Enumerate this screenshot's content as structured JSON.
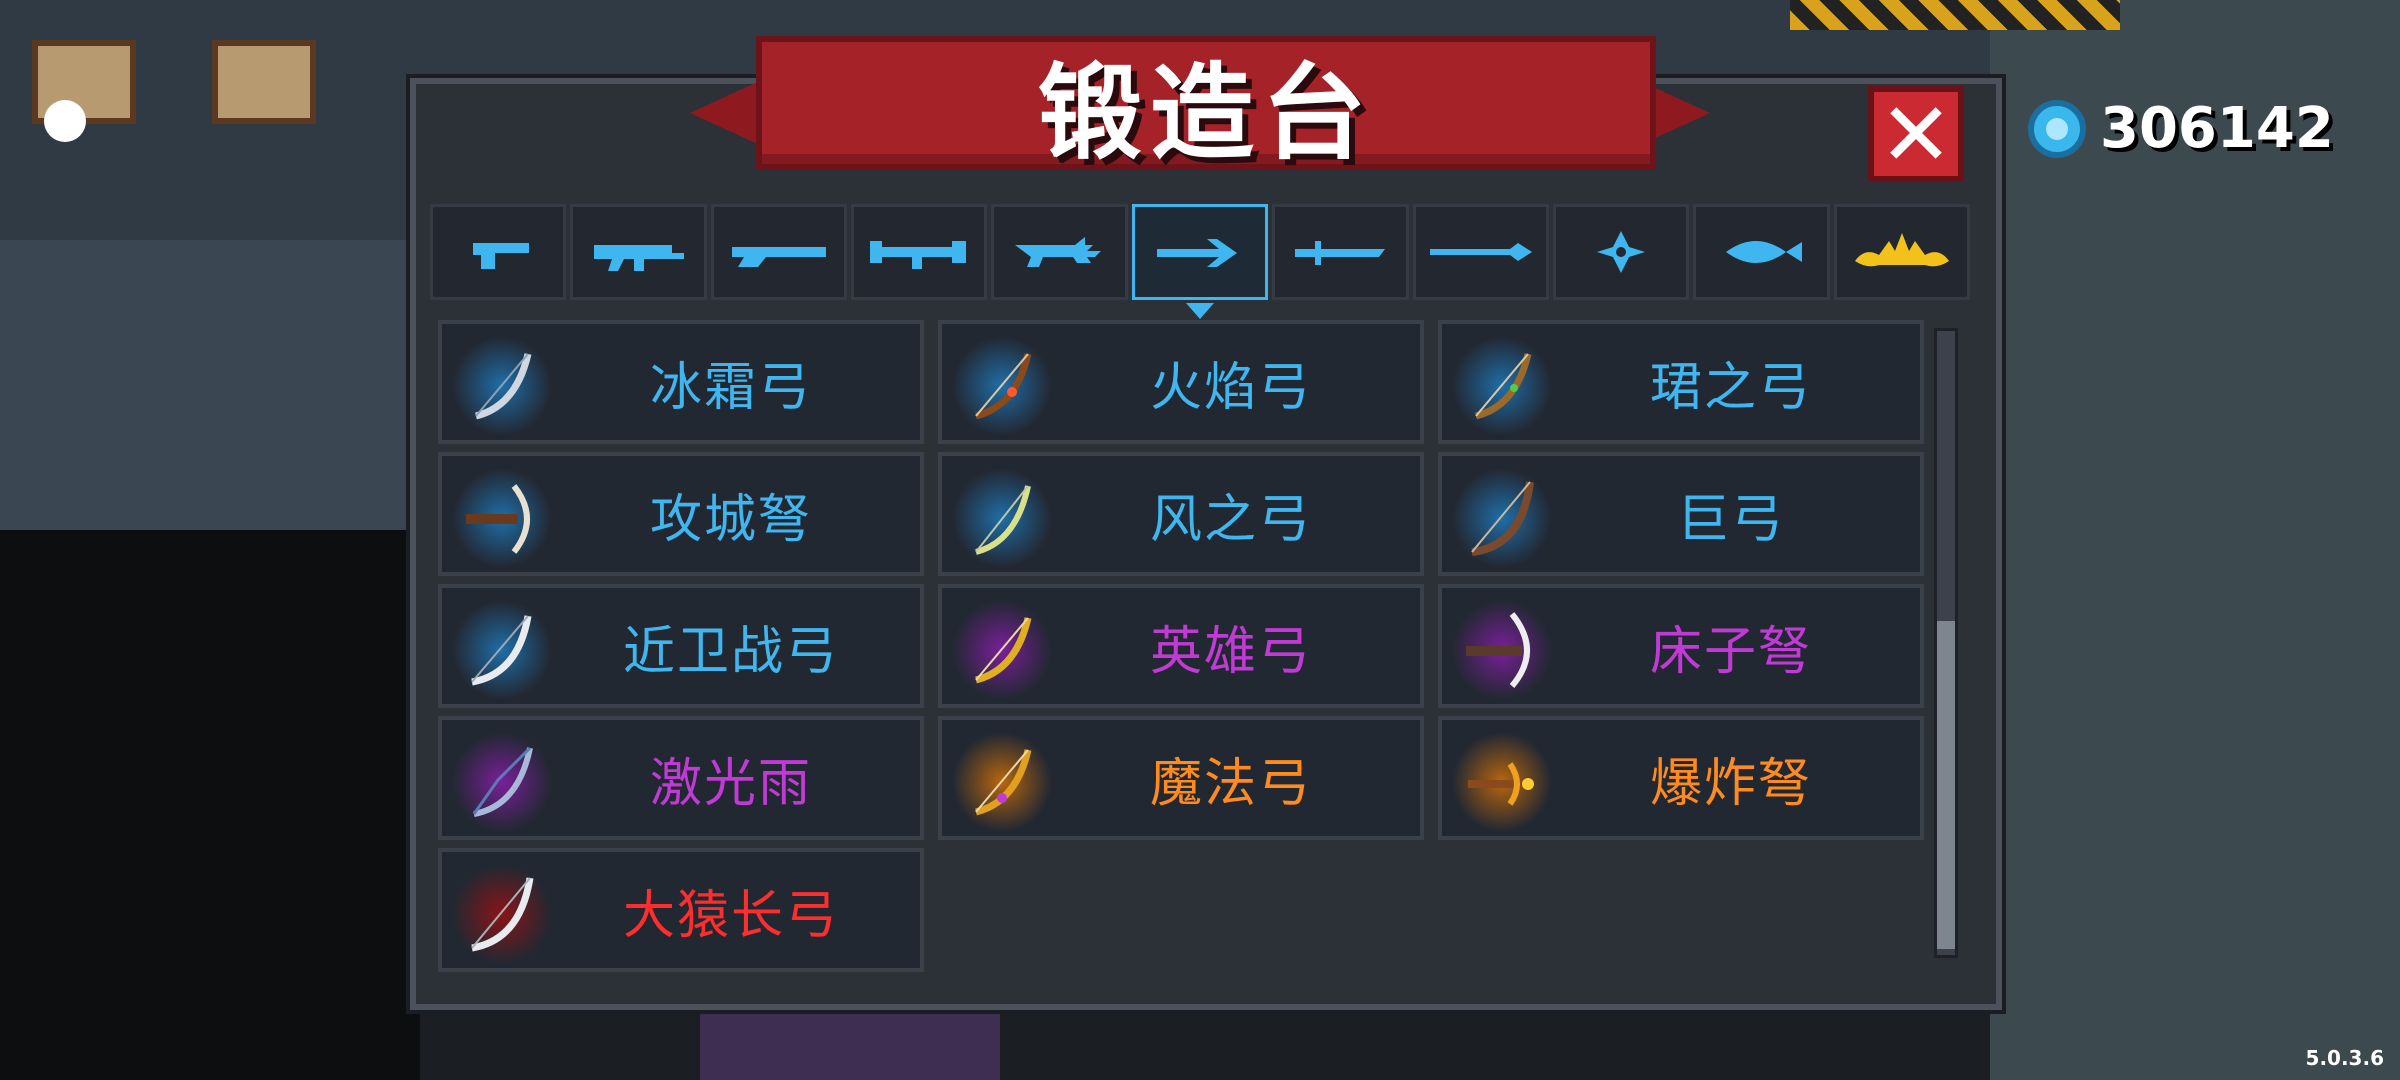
{
  "window": {
    "title": "锻造台"
  },
  "currency": {
    "icon": "gem-coin-icon",
    "value": "306142"
  },
  "tabs": [
    {
      "name": "pistol-tab",
      "icon": "pistol-icon",
      "active": false
    },
    {
      "name": "rifle-tab",
      "icon": "rifle-icon",
      "active": false
    },
    {
      "name": "shotgun-tab",
      "icon": "shotgun-icon",
      "active": false
    },
    {
      "name": "launcher-tab",
      "icon": "launcher-icon",
      "active": false
    },
    {
      "name": "laser-tab",
      "icon": "laser-gun-icon",
      "active": false
    },
    {
      "name": "bow-tab",
      "icon": "bow-icon",
      "active": true
    },
    {
      "name": "sword-tab",
      "icon": "sword-icon",
      "active": false
    },
    {
      "name": "spear-tab",
      "icon": "spear-icon",
      "active": false
    },
    {
      "name": "throwing-tab",
      "icon": "shuriken-icon",
      "active": false
    },
    {
      "name": "fish-tab",
      "icon": "fish-icon",
      "active": false
    },
    {
      "name": "special-tab",
      "icon": "crown-icon",
      "active": false
    }
  ],
  "items": [
    {
      "label": "冰霜弓",
      "rarity_color": "#3fb6f0"
    },
    {
      "label": "火焰弓",
      "rarity_color": "#3fb6f0"
    },
    {
      "label": "珺之弓",
      "rarity_color": "#3fb6f0"
    },
    {
      "label": "攻城弩",
      "rarity_color": "#3fb6f0"
    },
    {
      "label": "风之弓",
      "rarity_color": "#3fb6f0"
    },
    {
      "label": "巨弓",
      "rarity_color": "#3fb6f0"
    },
    {
      "label": "近卫战弓",
      "rarity_color": "#3fb6f0"
    },
    {
      "label": "英雄弓",
      "rarity_color": "#c23ad6"
    },
    {
      "label": "床子弩",
      "rarity_color": "#c23ad6"
    },
    {
      "label": "激光雨",
      "rarity_color": "#c23ad6"
    },
    {
      "label": "魔法弓",
      "rarity_color": "#ff8a1e"
    },
    {
      "label": "爆炸弩",
      "rarity_color": "#ff8a1e"
    },
    {
      "label": "大猿长弓",
      "rarity_color": "#ff2e2e"
    }
  ],
  "footer": {
    "version": "5.0.3.6"
  },
  "colors": {
    "accent": "#3fb6f0",
    "banner": "#a52229",
    "close": "#cc2a33"
  }
}
